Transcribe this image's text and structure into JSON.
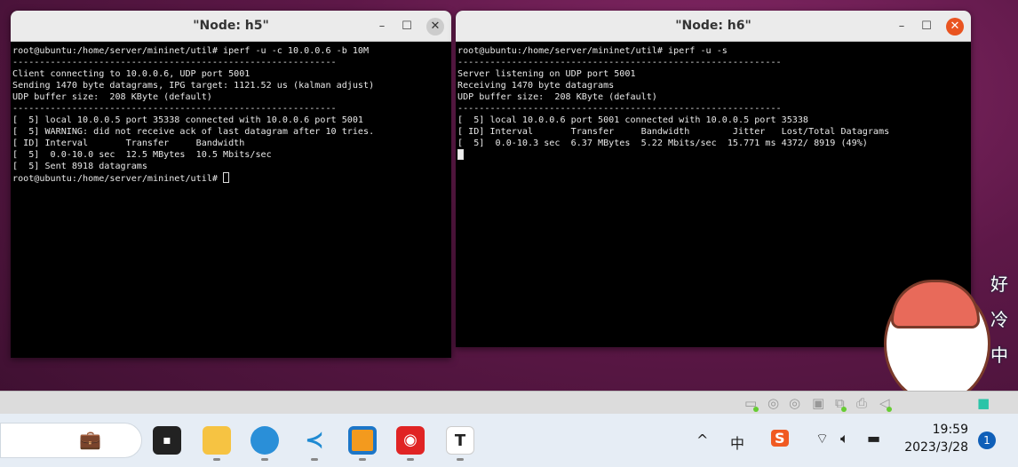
{
  "windows": [
    {
      "title": "\"Node: h5\"",
      "lines": [
        "root@ubuntu:/home/server/mininet/util# iperf -u -c 10.0.0.6 -b 10M",
        "------------------------------------------------------------",
        "Client connecting to 10.0.0.6, UDP port 5001",
        "Sending 1470 byte datagrams, IPG target: 1121.52 us (kalman adjust)",
        "UDP buffer size:  208 KByte (default)",
        "------------------------------------------------------------",
        "[  5] local 10.0.0.5 port 35338 connected with 10.0.0.6 port 5001",
        "[  5] WARNING: did not receive ack of last datagram after 10 tries.",
        "[ ID] Interval       Transfer     Bandwidth",
        "[  5]  0.0-10.0 sec  12.5 MBytes  10.5 Mbits/sec",
        "[  5] Sent 8918 datagrams"
      ],
      "prompt": "root@ubuntu:/home/server/mininet/util# "
    },
    {
      "title": "\"Node: h6\"",
      "lines": [
        "root@ubuntu:/home/server/mininet/util# iperf -u -s",
        "------------------------------------------------------------",
        "Server listening on UDP port 5001",
        "Receiving 1470 byte datagrams",
        "UDP buffer size:  208 KByte (default)",
        "------------------------------------------------------------",
        "[  5] local 10.0.0.6 port 5001 connected with 10.0.0.5 port 35338",
        "[ ID] Interval       Transfer     Bandwidth        Jitter   Lost/Total Datagrams",
        "[  5]  0.0-10.3 sec  6.37 MBytes  5.22 Mbits/sec  15.771 ms 4372/ 8919 (49%)"
      ]
    }
  ],
  "window_buttons": {
    "minimize": "–",
    "maximize": "☐",
    "close": "✕"
  },
  "sticker": {
    "text": "好冷中"
  },
  "taskbar": {
    "apps": [
      "file-explorer",
      "edge",
      "vscode",
      "virtualbox",
      "netease-music",
      "typora"
    ],
    "typora_label": "T",
    "time": "19:59",
    "date": "2023/3/28",
    "ime": "中",
    "sogou": "S",
    "notification_count": "1"
  },
  "colors": {
    "close_active": "#e95420",
    "terminal_bg": "#000000",
    "taskbar": "#e6edf5"
  }
}
